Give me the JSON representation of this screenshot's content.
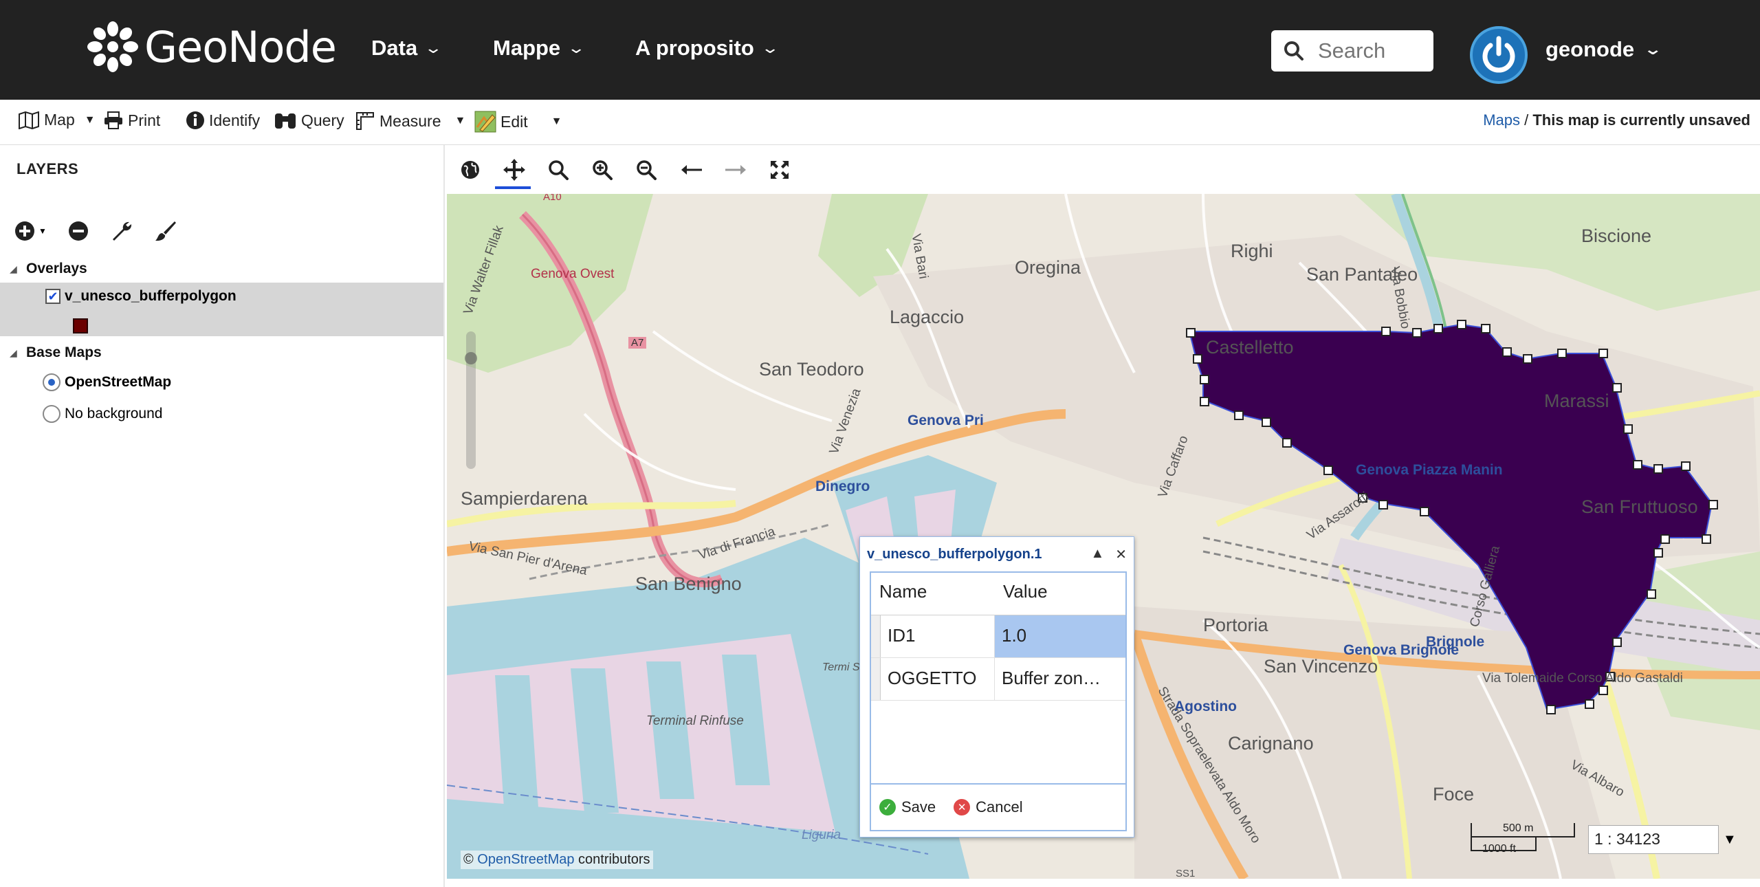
{
  "brand": {
    "name": "GeoNode"
  },
  "nav": {
    "items": [
      {
        "label": "Data"
      },
      {
        "label": "Mappe"
      },
      {
        "label": "A proposito"
      }
    ],
    "search_placeholder": "Search",
    "user": "geonode"
  },
  "toolbar": {
    "map": "Map",
    "print": "Print",
    "identify": "Identify",
    "query": "Query",
    "measure": "Measure",
    "edit": "Edit",
    "breadcrumb_link": "Maps",
    "breadcrumb_sep": " / ",
    "breadcrumb_current": "This map is currently unsaved"
  },
  "layers": {
    "title": "LAYERS",
    "overlays_label": "Overlays",
    "layer_name": "v_unesco_bufferpolygon",
    "layer_checked": true,
    "legend_color": "#6b0000",
    "base_maps_label": "Base Maps",
    "base_maps": [
      {
        "label": "OpenStreetMap",
        "selected": true
      },
      {
        "label": "No background",
        "selected": false
      }
    ]
  },
  "map": {
    "places": [
      "Oregina",
      "Righi",
      "San Pantaleo",
      "Biscione",
      "Lagaccio",
      "Castelletto",
      "San Teodoro",
      "Marassi",
      "Sampierdarena",
      "San Fruttuoso",
      "San Benigno",
      "Portoria",
      "San Vincenzo",
      "Carignano",
      "Foce",
      "Genova Ovest",
      "Terminal Rinfuse",
      "Liguria"
    ],
    "blue_labels": [
      "Dinegro",
      "Genova Piazza Manin",
      "Brignole",
      "Genova Brignole",
      "Genova Pri",
      "Agostino"
    ],
    "streets": [
      "Via Bari",
      "Via Venezia",
      "Via Caffaro",
      "Via Assarotti",
      "Via Bobbio",
      "Corso Galliera",
      "Via di Francia",
      "Via San Pier d'Arena",
      "Via Tolemaide Corso Aldo Gastaldi",
      "Via Albaro",
      "Strada Sopraelevata Aldo Moro",
      "Via Walter Fillak",
      "A7",
      "A10",
      "SS1",
      "Termi SECH"
    ],
    "attribution_prefix": "© ",
    "attribution_link": "OpenStreetMap",
    "attribution_suffix": " contributors",
    "scale_top": "500 m",
    "scale_bottom": "1000 ft",
    "scale_ratio": "1 : 34123",
    "polygon_fill": "#3a0050"
  },
  "popup": {
    "title": "v_unesco_bufferpolygon.1",
    "col_name": "Name",
    "col_value": "Value",
    "rows": [
      {
        "name": "ID1",
        "value": "1.0"
      },
      {
        "name": "OGGETTO",
        "value": "Buffer zon…"
      }
    ],
    "save": "Save",
    "cancel": "Cancel"
  }
}
